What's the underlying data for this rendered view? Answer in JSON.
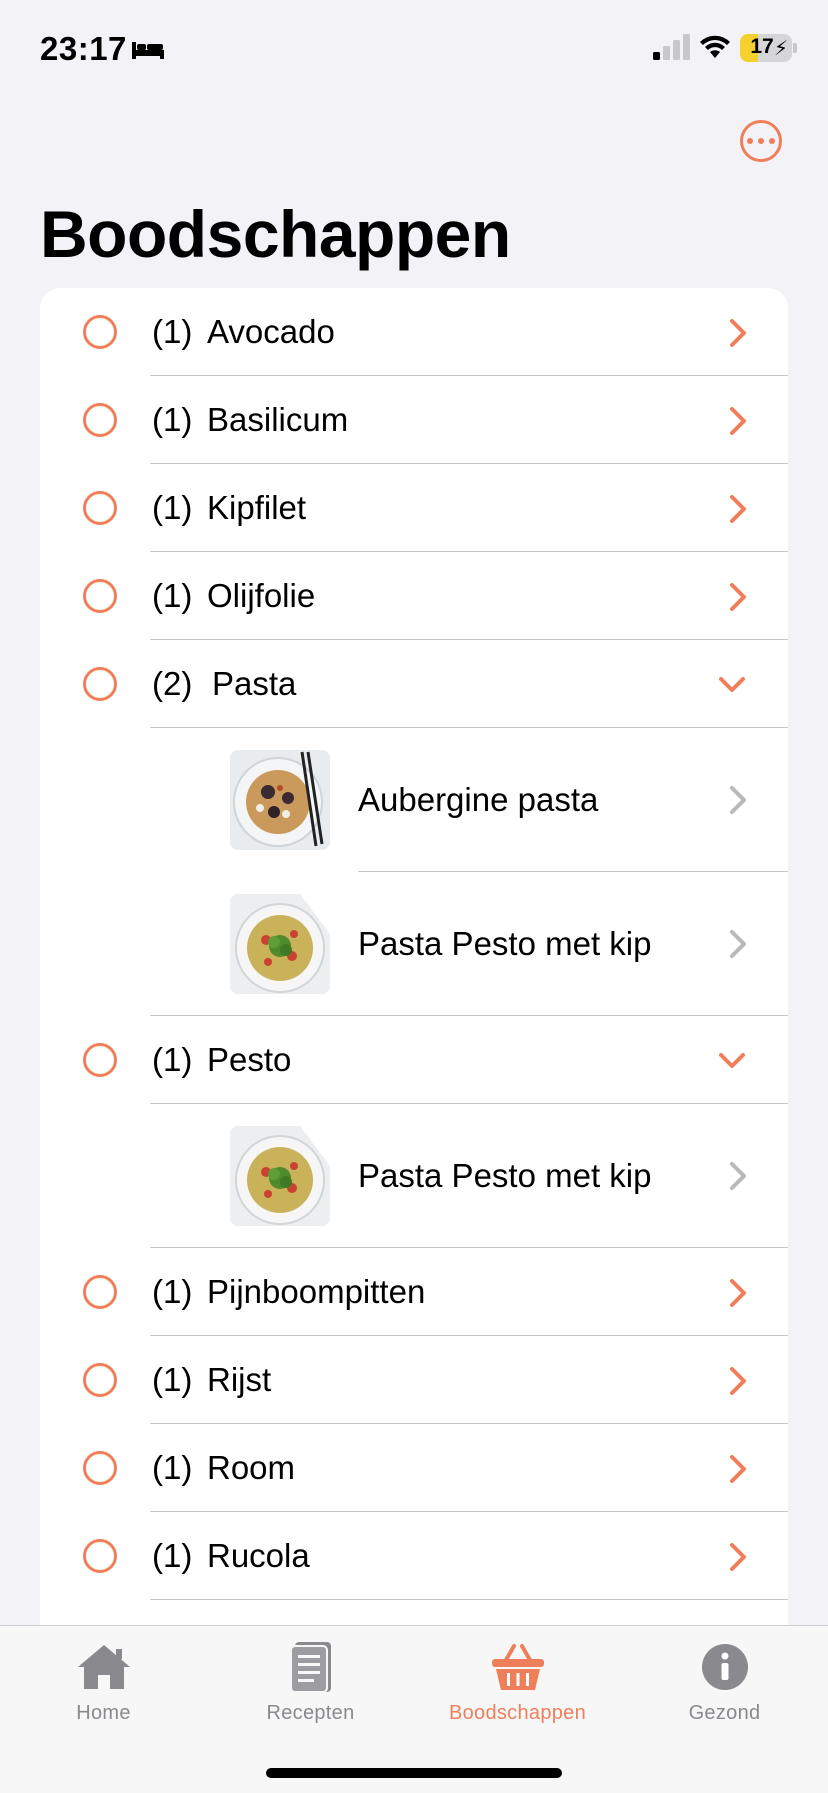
{
  "status_bar": {
    "time": "23:17",
    "battery": "17"
  },
  "header": {
    "title": "Boodschappen"
  },
  "items": [
    {
      "qty": "(1)",
      "name": "Avocado",
      "expanded": false,
      "recipes": []
    },
    {
      "qty": "(1)",
      "name": "Basilicum",
      "expanded": false,
      "recipes": []
    },
    {
      "qty": "(1)",
      "name": "Kipfilet",
      "expanded": false,
      "recipes": []
    },
    {
      "qty": "(1)",
      "name": "Olijfolie",
      "expanded": false,
      "recipes": []
    },
    {
      "qty": "(2)",
      "name": "Pasta",
      "expanded": true,
      "recipes": [
        {
          "title": "Aubergine pasta",
          "image": "aubergine-pasta-thumbnail"
        },
        {
          "title": "Pasta Pesto met kip",
          "image": "pasta-pesto-thumbnail"
        }
      ]
    },
    {
      "qty": "(1)",
      "name": "Pesto",
      "expanded": true,
      "recipes": [
        {
          "title": "Pasta Pesto met kip",
          "image": "pasta-pesto-thumbnail"
        }
      ]
    },
    {
      "qty": "(1)",
      "name": "Pijnboompitten",
      "expanded": false,
      "recipes": []
    },
    {
      "qty": "(1)",
      "name": "Rijst",
      "expanded": false,
      "recipes": []
    },
    {
      "qty": "(1)",
      "name": "Room",
      "expanded": false,
      "recipes": []
    },
    {
      "qty": "(1)",
      "name": "Rucola",
      "expanded": false,
      "recipes": []
    }
  ],
  "tabs": [
    {
      "label": "Home",
      "icon": "home-icon",
      "active": false
    },
    {
      "label": "Recepten",
      "icon": "book-icon",
      "active": false
    },
    {
      "label": "Boodschappen",
      "icon": "basket-icon",
      "active": true
    },
    {
      "label": "Gezond",
      "icon": "info-icon",
      "active": false
    }
  ],
  "colors": {
    "accent": "#ef7f5a",
    "inactive": "#8a8a8e",
    "background": "#f2f2f7"
  }
}
